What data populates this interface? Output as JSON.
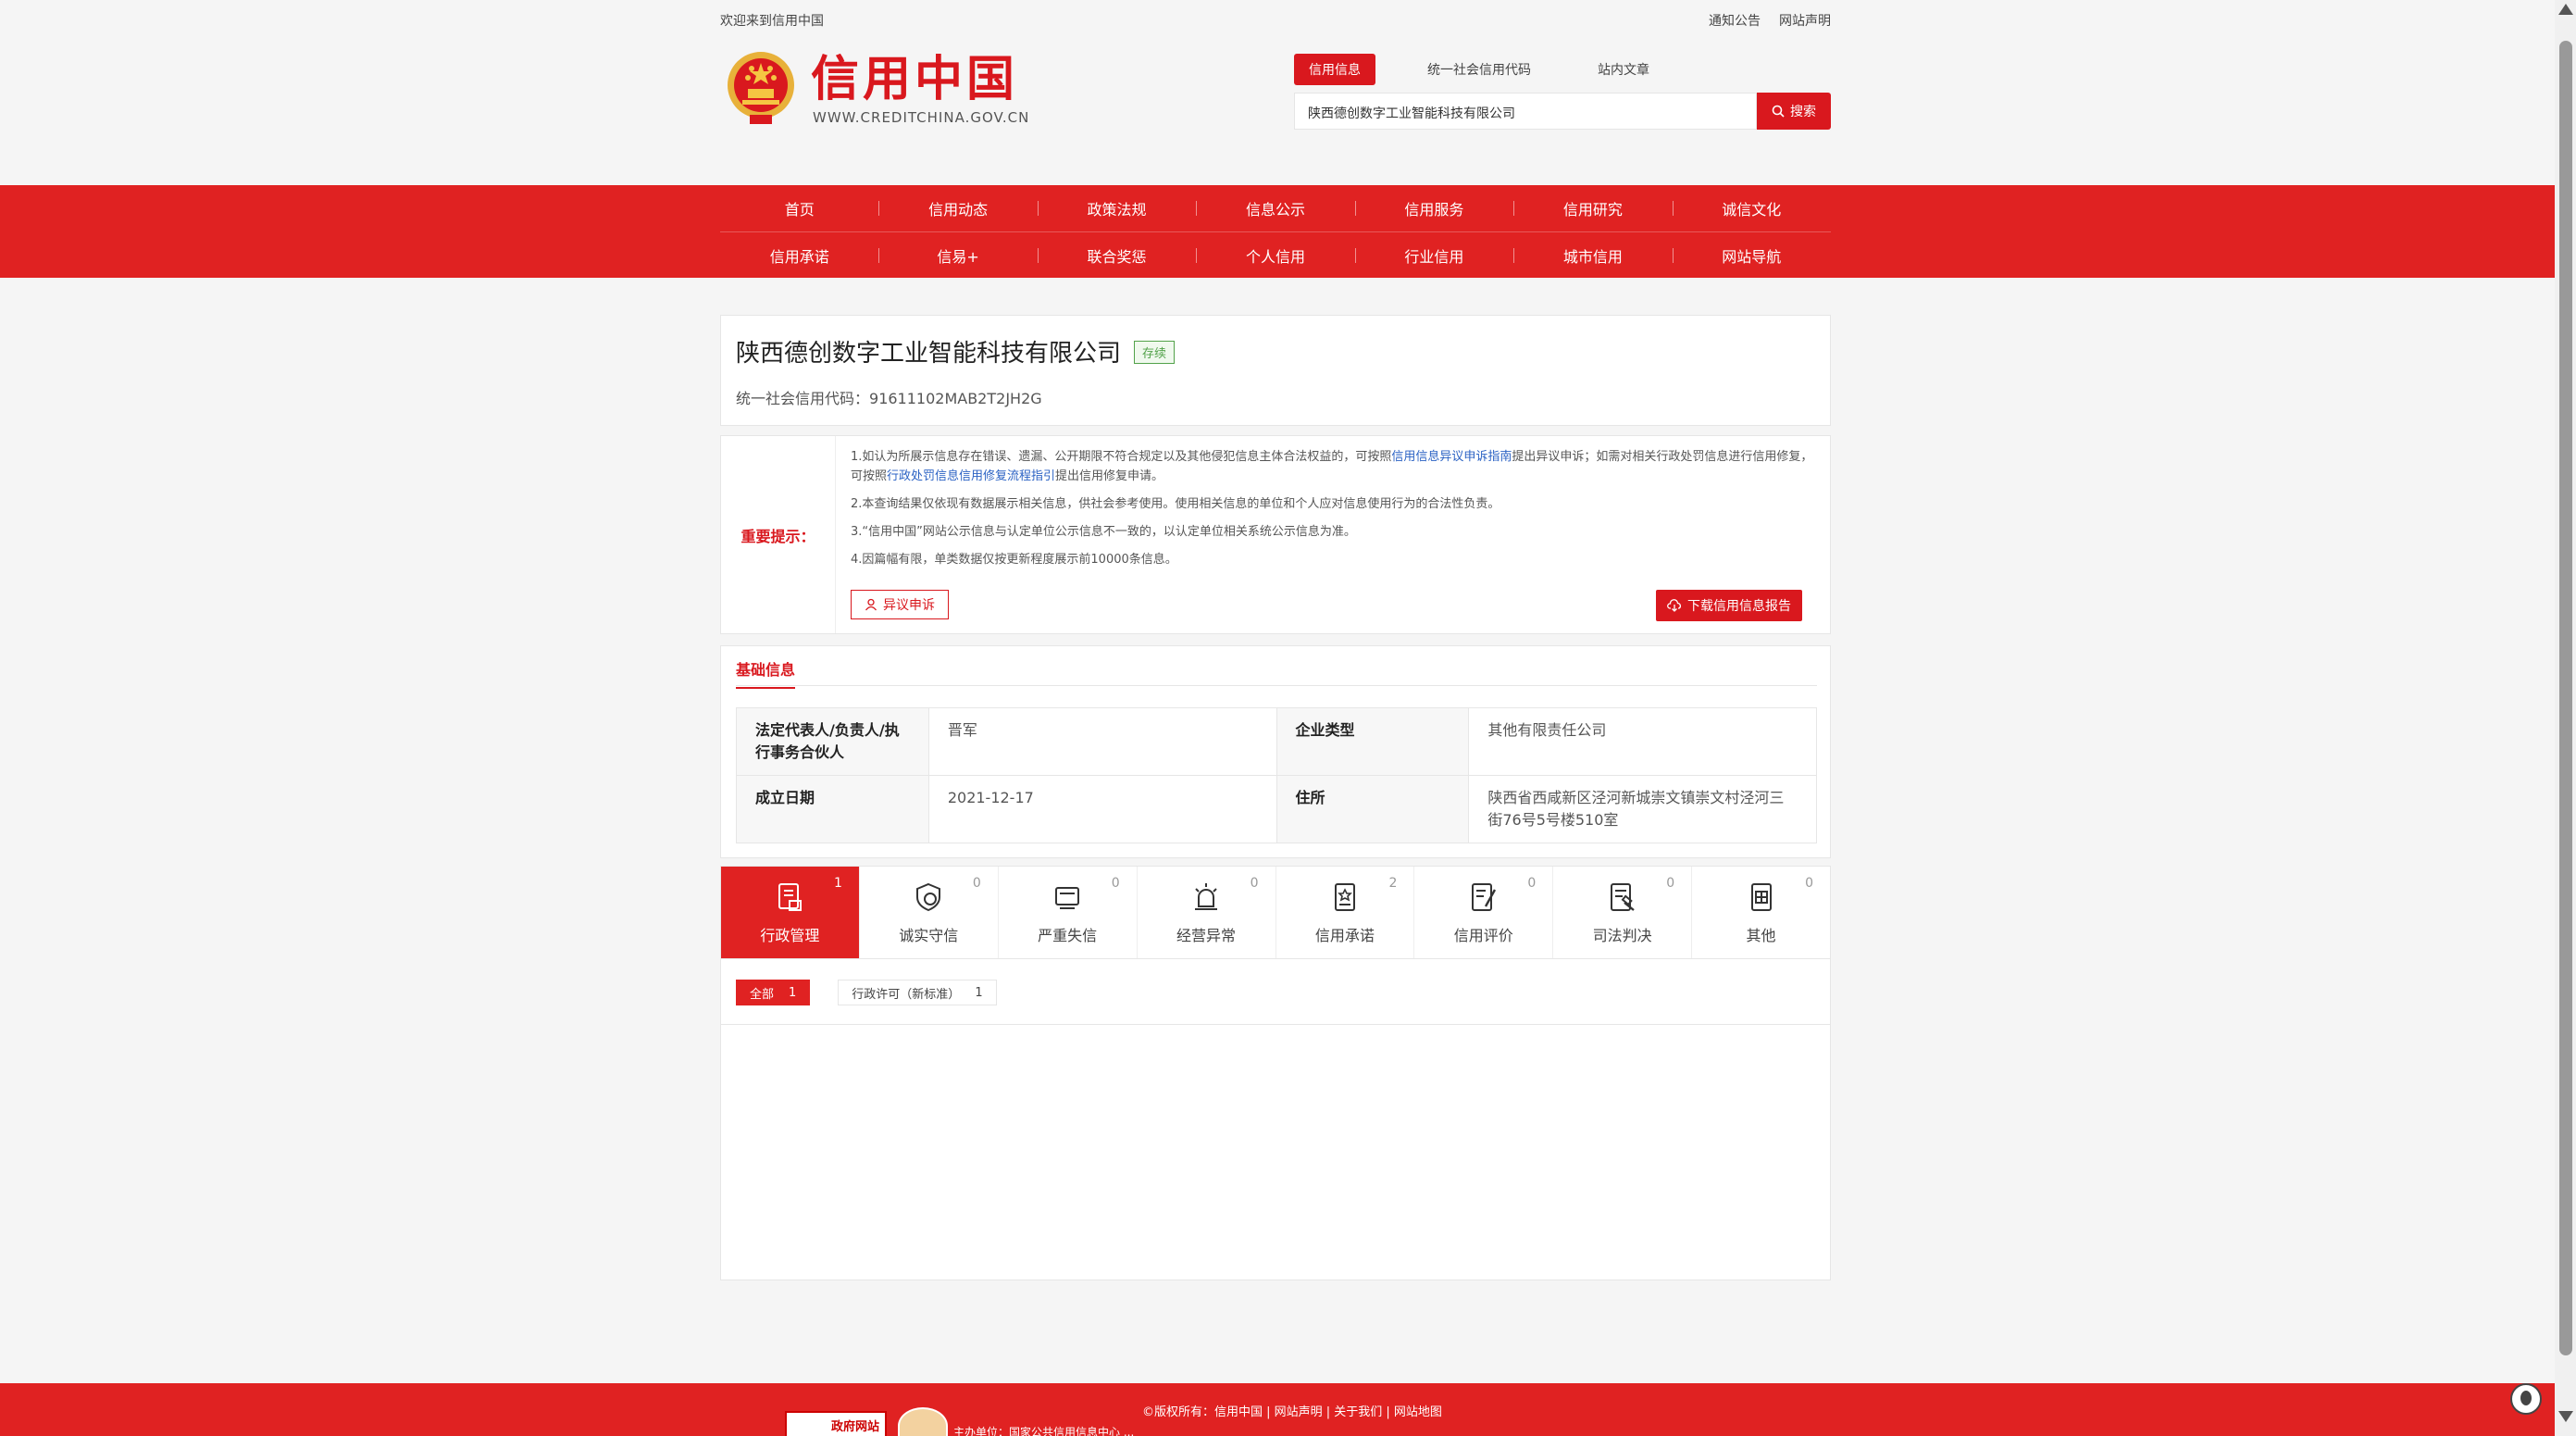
{
  "topbar": {
    "welcome": "欢迎来到信用中国",
    "links": [
      "通知公告",
      "网站声明"
    ]
  },
  "header": {
    "brand": "信用中国",
    "brand_url": "WWW.CREDITCHINA.GOV.CN",
    "search_tabs": [
      "信用信息",
      "统一社会信用代码",
      "站内文章"
    ],
    "search_value": "陕西德创数字工业智能科技有限公司",
    "search_button": "搜索"
  },
  "nav": {
    "row1": [
      "首页",
      "信用动态",
      "政策法规",
      "信息公示",
      "信用服务",
      "信用研究",
      "诚信文化"
    ],
    "row2": [
      "信用承诺",
      "信易+",
      "联合奖惩",
      "个人信用",
      "行业信用",
      "城市信用",
      "网站导航"
    ]
  },
  "company": {
    "name": "陕西德创数字工业智能科技有限公司",
    "status": "存续",
    "code_label": "统一社会信用代码：",
    "code": "91611102MAB2T2JH2G"
  },
  "notice": {
    "label": "重要提示：",
    "item1_a": "1.如认为所展示信息存在错误、遗漏、公开期限不符合规定以及其他侵犯信息主体合法权益的，可按照",
    "item1_link1": "信用信息异议申诉指南",
    "item1_b": "提出异议申诉；如需对相关行政处罚信息进行信用修复，可按照",
    "item1_link2": "行政处罚信息信用修复流程指引",
    "item1_c": "提出信用修复申请。",
    "item2": "2.本查询结果仅依现有数据展示相关信息，供社会参考使用。使用相关信息的单位和个人应对信息使用行为的合法性负责。",
    "item3": "3.“信用中国”网站公示信息与认定单位公示信息不一致的，以认定单位相关系统公示信息为准。",
    "item4": "4.因篇幅有限，单类数据仅按更新程度展示前10000条信息。",
    "objection_button": "异议申诉",
    "download_button": "下载信用信息报告"
  },
  "basic": {
    "title": "基础信息",
    "rows": [
      {
        "k1": "法定代表人/负责人/执行事务合伙人",
        "v1": "晋军",
        "k2": "企业类型",
        "v2": "其他有限责任公司"
      },
      {
        "k1": "成立日期",
        "v1": "2021-12-17",
        "k2": "住所",
        "v2": "陕西省西咸新区泾河新城崇文镇崇文村泾河三街76号5号楼510室"
      }
    ]
  },
  "categories": [
    {
      "label": "行政管理",
      "count": "1",
      "icon": "admin-icon"
    },
    {
      "label": "诚实守信",
      "count": "0",
      "icon": "honest-icon"
    },
    {
      "label": "严重失信",
      "count": "0",
      "icon": "dishonest-icon"
    },
    {
      "label": "经营异常",
      "count": "0",
      "icon": "alarm-icon"
    },
    {
      "label": "信用承诺",
      "count": "2",
      "icon": "promise-icon"
    },
    {
      "label": "信用评价",
      "count": "0",
      "icon": "evaluation-icon"
    },
    {
      "label": "司法判决",
      "count": "0",
      "icon": "judgment-icon"
    },
    {
      "label": "其他",
      "count": "0",
      "icon": "other-icon"
    }
  ],
  "sub_tabs": [
    {
      "label": "全部",
      "count": "1"
    },
    {
      "label": "行政许可（新标准）",
      "count": "1"
    }
  ],
  "footer": {
    "links": "©版权所有：信用中国 | 网站声明 | 关于我们 | 网站地图",
    "badge": "政府网站",
    "line2": "主办单位：国家公共信用信息中心 ..."
  },
  "colors": {
    "accent": "#e02222",
    "brand": "#d9181e",
    "status": "#52a24a",
    "link": "#2b62c4"
  }
}
